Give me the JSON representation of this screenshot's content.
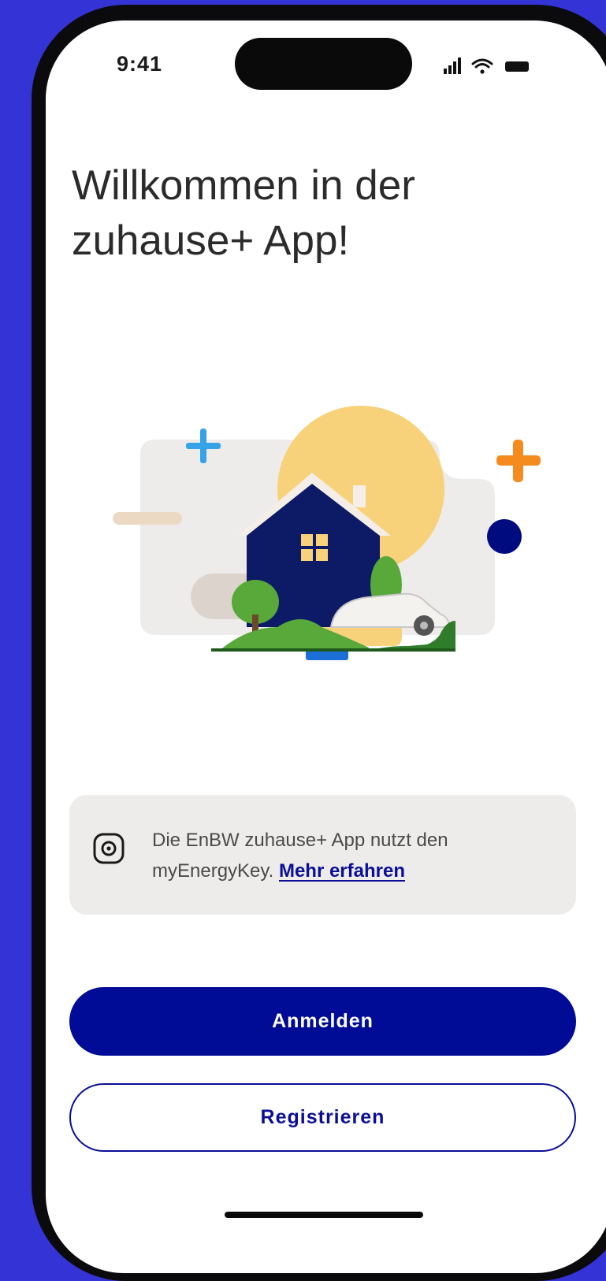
{
  "status_bar": {
    "time": "9:41"
  },
  "welcome": {
    "line1": "Willkommen in der",
    "line2": "zuhause+ App!"
  },
  "info_card": {
    "text": "Die EnBW zuhause+ App nutzt den myEnergyKey.",
    "link_label": "Mehr erfahren",
    "icon": "key-icon"
  },
  "actions": {
    "login_label": "Anmelden",
    "register_label": "Registrieren"
  },
  "colors": {
    "background": "#3434d6",
    "primary": "#000b96",
    "link": "#0a0f96",
    "card": "#eeecea",
    "sun": "#f8d27a",
    "accent_orange": "#f58a1f",
    "accent_blue": "#36a3e8"
  }
}
